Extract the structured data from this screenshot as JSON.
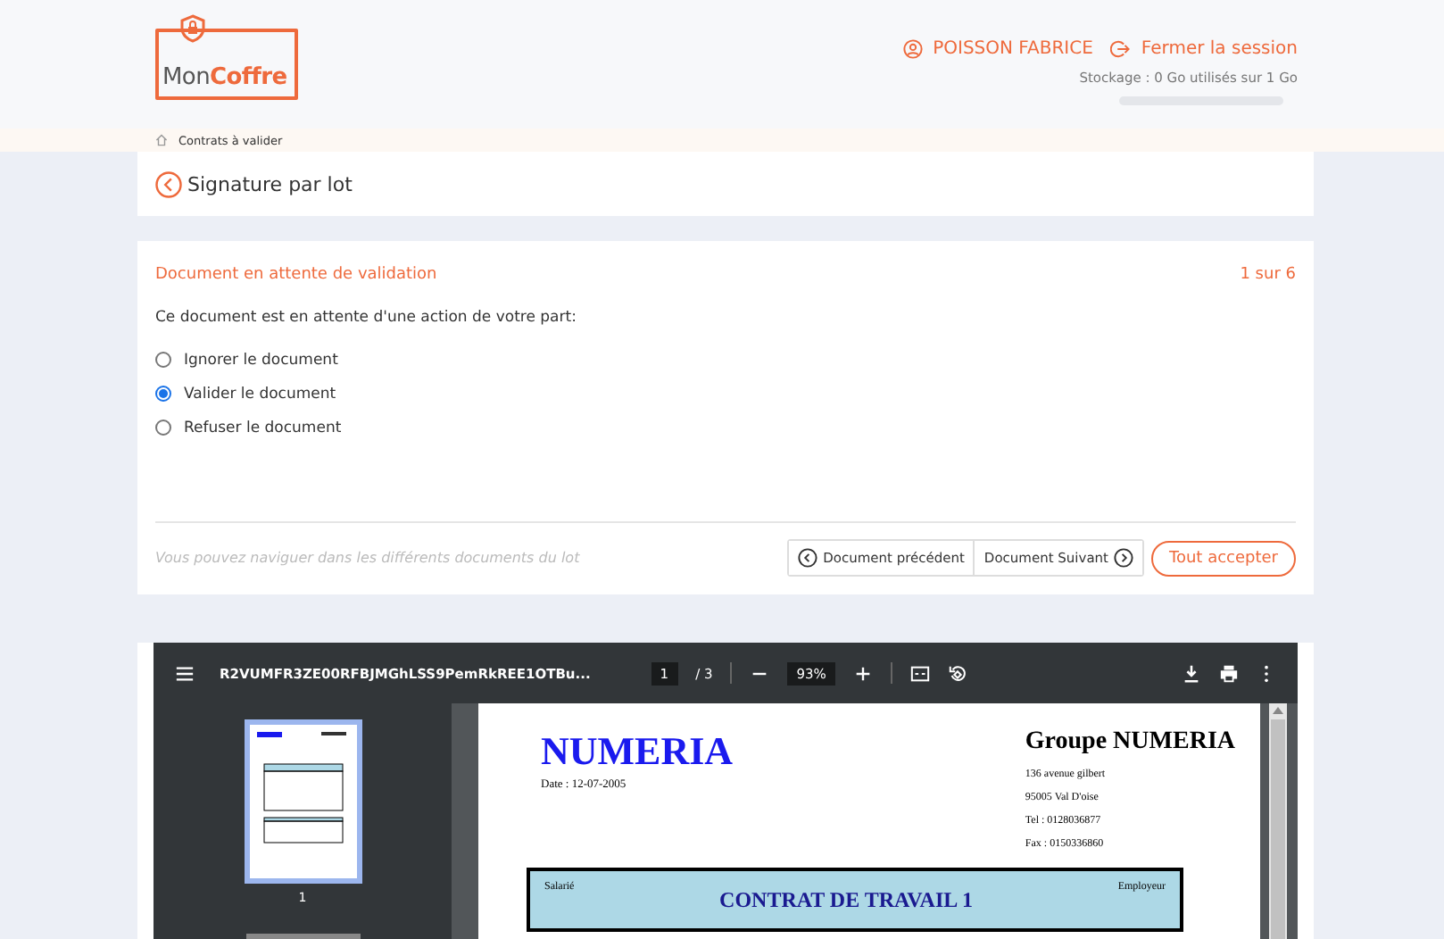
{
  "header": {
    "logo": {
      "part_1": "Mon",
      "part_2": "Coffre"
    },
    "user": "POISSON FABRICE",
    "logout": "Fermer la session",
    "storage": {
      "label": "Stockage : 0 Go utilisés sur 1 Go"
    }
  },
  "breadcrumb": [
    "Contrats à valider"
  ],
  "page_title": "Signature par lot",
  "document_card": {
    "status": "Document en attente de validation",
    "counter": "1 sur 6",
    "prompt": "Ce document est en attente d'une action de votre part:",
    "options": [
      {
        "label": "Ignorer le document",
        "selected": false
      },
      {
        "label": "Valider le document",
        "selected": true
      },
      {
        "label": "Refuser le document",
        "selected": false
      }
    ],
    "hint": "Vous pouvez naviguer dans les différents documents du lot",
    "previous": "Document précédent",
    "next": "Document Suivant",
    "accept_all": "Tout accepter"
  },
  "pdf_viewer": {
    "file_name": "R2VUMFR3ZE00RFBJMGhLSS9PemRkREE1OTBu...",
    "page": "1",
    "page_total": "/ 3",
    "zoom": "93%",
    "thumbnails": [
      {
        "label": "1",
        "selected": true
      }
    ],
    "document": {
      "company": "NUMERIA",
      "date": "Date : 12-07-2005",
      "group": "Groupe NUMERIA",
      "address_lines": [
        "136 avenue gilbert",
        "95005 Val D'oise",
        "Tel : 0128036877",
        "Fax : 0150336860"
      ],
      "table_left": "Salarié",
      "table_title": "CONTRAT DE TRAVAIL 1",
      "table_right": "Employeur"
    }
  }
}
